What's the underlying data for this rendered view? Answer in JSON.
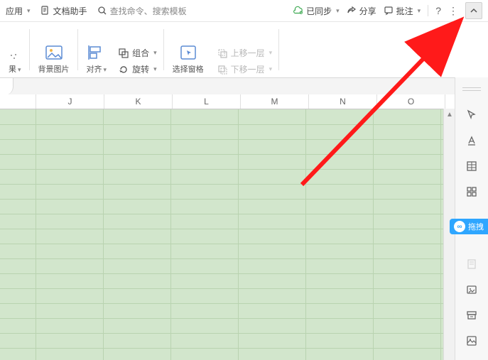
{
  "topbar": {
    "apply": "应用",
    "doc_helper": "文档助手",
    "search_placeholder": "查找命令、搜索模板",
    "sync": "已同步",
    "share": "分享",
    "annotate": "批注"
  },
  "ribbon": {
    "result": "果",
    "bg_image": "背景图片",
    "align": "对齐",
    "combine": "组合",
    "rotate": "旋转",
    "select_pane": "选择窗格",
    "move_up": "上移一层",
    "move_down": "下移一层"
  },
  "columns": [
    "J",
    "K",
    "L",
    "M",
    "N",
    "O"
  ],
  "side": {
    "drag": "拖拽"
  },
  "colors": {
    "grid_fill": "#d2e6cc",
    "accent": "#2ea6ff"
  }
}
